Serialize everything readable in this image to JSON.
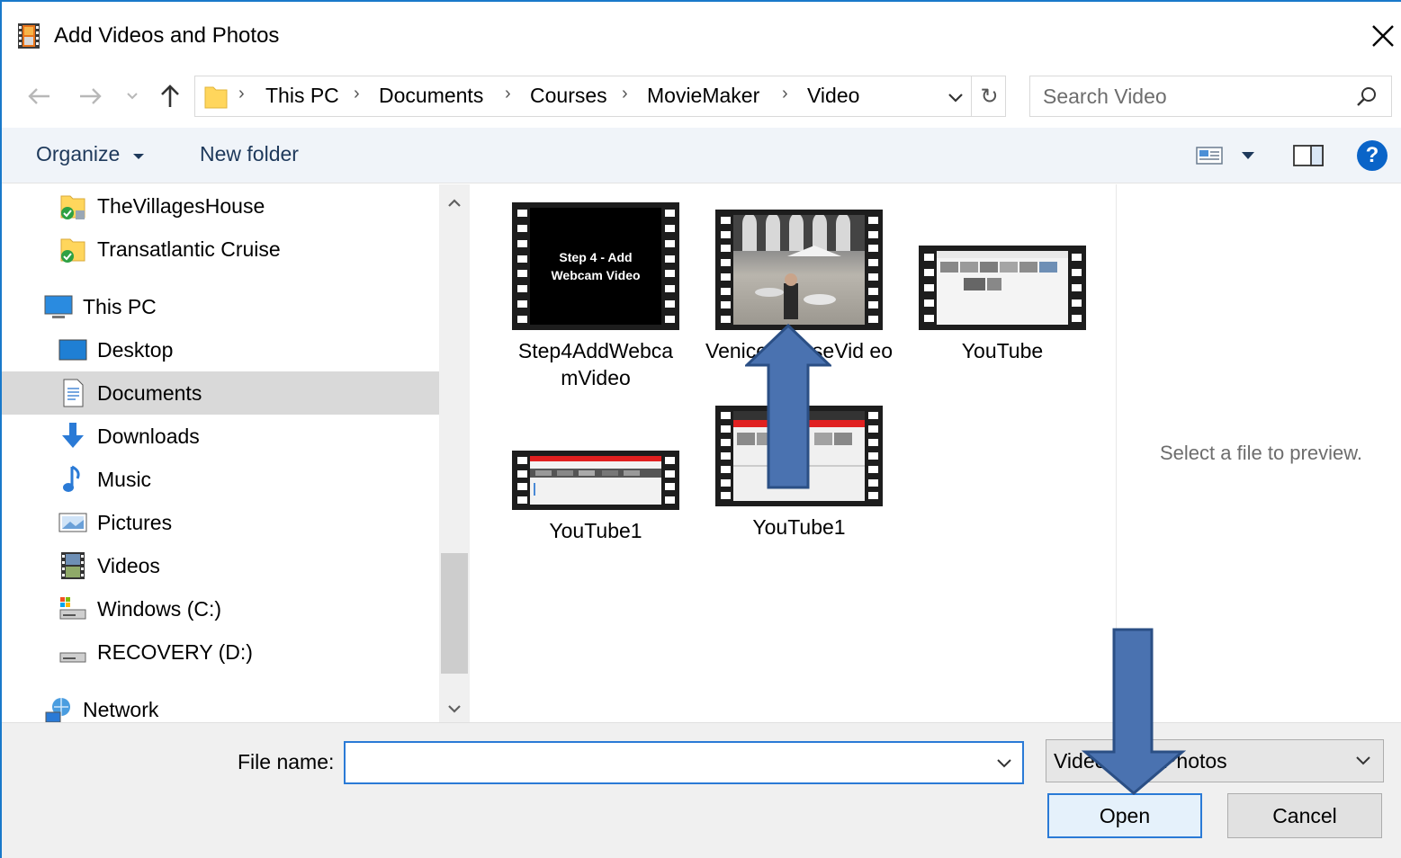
{
  "window": {
    "title": "Add Videos and Photos"
  },
  "address": {
    "crumbs": [
      "This PC",
      "Documents",
      "Courses",
      "MovieMaker",
      "Video"
    ]
  },
  "search": {
    "placeholder": "Search Video"
  },
  "toolbar": {
    "organize_label": "Organize",
    "new_folder_label": "New folder",
    "help_label": "?"
  },
  "nav": {
    "items": [
      {
        "label": "TheVillagesHouse",
        "icon": "folder-sync-icon"
      },
      {
        "label": "Transatlantic Cruise",
        "icon": "folder-sync-icon"
      },
      {
        "label": "This PC",
        "icon": "computer-icon"
      },
      {
        "label": "Desktop",
        "icon": "desktop-icon"
      },
      {
        "label": "Documents",
        "icon": "documents-icon",
        "selected": true
      },
      {
        "label": "Downloads",
        "icon": "downloads-icon"
      },
      {
        "label": "Music",
        "icon": "music-icon"
      },
      {
        "label": "Pictures",
        "icon": "pictures-icon"
      },
      {
        "label": "Videos",
        "icon": "videos-icon"
      },
      {
        "label": "Windows (C:)",
        "icon": "drive-icon"
      },
      {
        "label": "RECOVERY (D:)",
        "icon": "drive-icon"
      },
      {
        "label": "Network",
        "icon": "network-icon"
      }
    ]
  },
  "files": [
    {
      "label": "Step4AddWebca mVideo",
      "thumb_text": "Step 4 - Add Webcam Video"
    },
    {
      "label": "VeniceCourseVid eo"
    },
    {
      "label": "YouTube"
    },
    {
      "label": "YouTube1"
    },
    {
      "label": "YouTube1"
    }
  ],
  "preview": {
    "text": "Select a file to preview."
  },
  "footer": {
    "filename_label": "File name:",
    "filename_value": "",
    "filetype_value": "Videos and Photos",
    "open_label": "Open",
    "cancel_label": "Cancel"
  },
  "colors": {
    "accent": "#1979ca",
    "annotation_arrow": "#4a72b0",
    "annotation_arrow_border": "#2b4f85"
  }
}
